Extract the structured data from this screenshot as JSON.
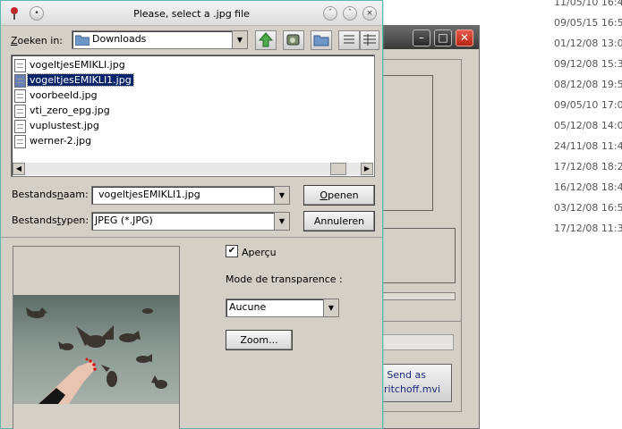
{
  "background": {
    "dates": [
      "11/05/10 16:4",
      "09/05/15 16:5",
      "01/12/08 13:0",
      "09/12/08 15:3",
      "08/12/08 19:5",
      "09/05/10 17:0",
      "05/12/08 14:0",
      "24/11/08 11:4",
      "17/12/08 18:2",
      "16/12/08 18:4",
      "03/12/08 16:5",
      "17/12/08 11:3"
    ],
    "window": {
      "send_button_line1": "Send as",
      "send_button_line2": "ritchoff.mvi"
    }
  },
  "dialog": {
    "title": "Please, select a .jpg file",
    "look_in": {
      "label_pre": "",
      "label_u": "Z",
      "label_post": "oeken in:",
      "value": "Downloads"
    },
    "files": [
      "vogeltjesEMIKLI.jpg",
      "vogeltjesEMIKLI1.jpg",
      "voorbeeld.jpg",
      "vti_zero_epg.jpg",
      "vuplustest.jpg",
      "werner-2.jpg"
    ],
    "selected_index": 1,
    "filename": {
      "label_pre": "Bestands",
      "label_u": "n",
      "label_post": "aam:",
      "value": "vogeltjesEMIKLI1.jpg"
    },
    "filetype": {
      "label_pre": "Bestands",
      "label_u": "t",
      "label_post": "ypen:",
      "value": "JPEG (*.JPG)"
    },
    "open_button": {
      "pre": "",
      "u": "O",
      "post": "penen"
    },
    "cancel_button": "Annuleren",
    "preview_checkbox": {
      "label": "Aperçu",
      "checked": true
    },
    "transparency_label": "Mode de transparence :",
    "transparency_value": "Aucune",
    "zoom_button": "Zoom..."
  }
}
